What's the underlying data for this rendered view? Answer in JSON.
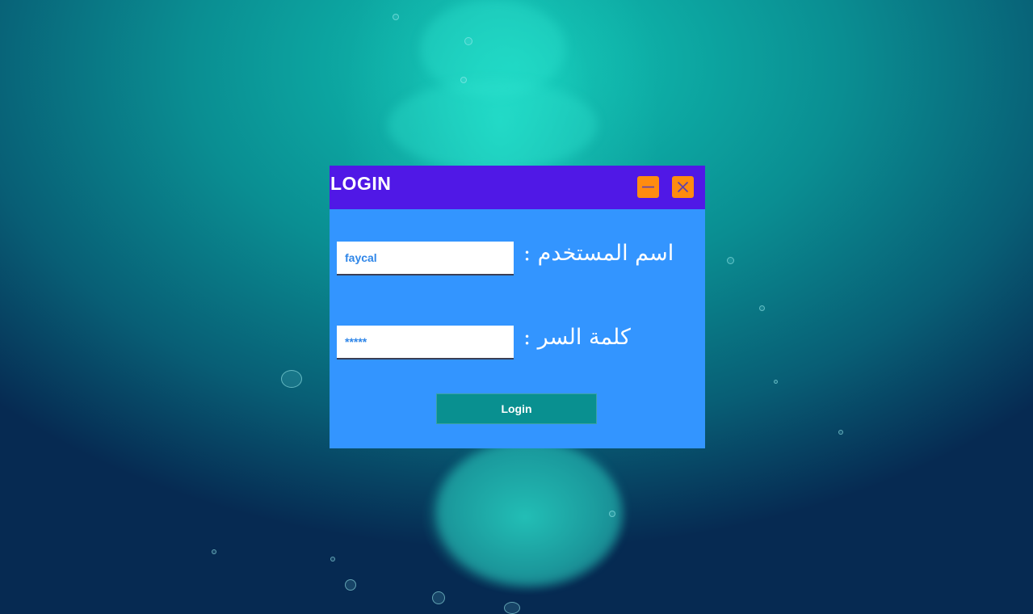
{
  "window": {
    "title": "LOGIN",
    "minimize_icon": "minimize-icon",
    "close_icon": "close-icon"
  },
  "form": {
    "username_label": "اسم المستخدم :",
    "username_value": "faycal",
    "password_label": "كلمة السر :",
    "password_value": "*****",
    "login_button_label": "Login"
  },
  "colors": {
    "titlebar": "#5018e6",
    "body": "#3395ff",
    "window_buttons": "#ff8c0f",
    "login_button": "#099090"
  }
}
